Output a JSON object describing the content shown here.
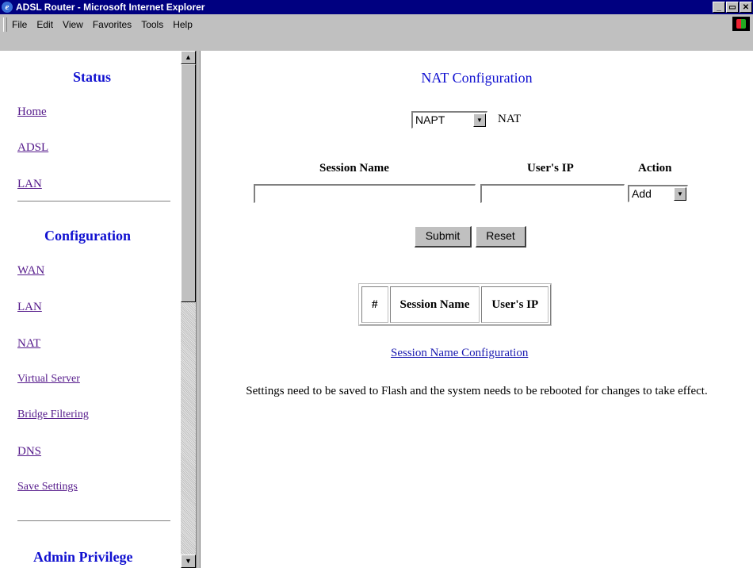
{
  "window": {
    "title": "ADSL Router - Microsoft Internet Explorer",
    "buttons": [
      "_",
      "▭",
      "✕"
    ]
  },
  "menu": [
    "File",
    "Edit",
    "View",
    "Favorites",
    "Tools",
    "Help"
  ],
  "sidebar": {
    "status_title": "Status",
    "status_links": [
      "Home",
      "ADSL",
      "LAN"
    ],
    "config_title": "Configuration",
    "config_links": [
      "WAN",
      "LAN",
      "NAT",
      "Virtual Server",
      "Bridge Filtering",
      "DNS",
      "Save Settings"
    ],
    "admin_title": "Admin Privilege"
  },
  "main": {
    "title": "NAT Configuration",
    "mode_select": "NAPT",
    "mode_label": "NAT",
    "form": {
      "session_name_header": "Session Name",
      "users_ip_header": "User's IP",
      "action_header": "Action",
      "session_name_value": "",
      "users_ip_value": "",
      "action_select": "Add"
    },
    "submit_label": "Submit",
    "reset_label": "Reset",
    "table_headers": [
      "#",
      "Session Name",
      "User's IP"
    ],
    "link": "Session Name Configuration",
    "note": "Settings need to be saved to Flash and the system needs to be rebooted for changes to take effect."
  }
}
